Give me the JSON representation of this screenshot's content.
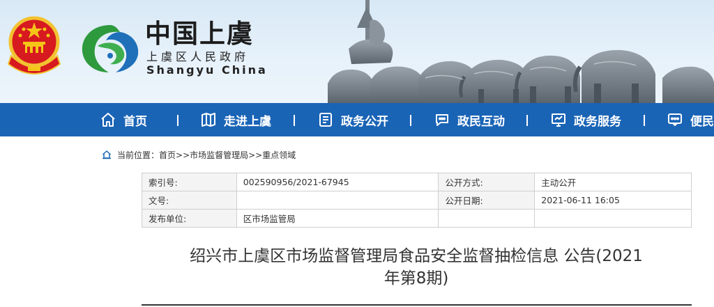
{
  "header": {
    "site_name": "中国上虞",
    "site_subtitle": "上虞区人民政府",
    "site_english": "Shangyu China"
  },
  "nav": {
    "items": [
      {
        "label": "首页",
        "icon": "home-icon"
      },
      {
        "label": "走进上虞",
        "icon": "map-icon"
      },
      {
        "label": "政务公开",
        "icon": "document-icon"
      },
      {
        "label": "政民互动",
        "icon": "chat-icon"
      },
      {
        "label": "政务服务",
        "icon": "monitor-icon"
      },
      {
        "label": "便民",
        "icon": "message-icon"
      }
    ]
  },
  "breadcrumb": {
    "prefix": "当前位置：",
    "path": "首页>>市场监督管理局>>重点领域"
  },
  "info": {
    "index_label": "索引号:",
    "index_value": "002590956/2021-67945",
    "publish_method_label": "公开方式:",
    "publish_method_value": "主动公开",
    "doc_no_label": "文号:",
    "doc_no_value": "",
    "publish_date_label": "公开日期:",
    "publish_date_value": "2021-06-11 16:05",
    "issuer_label": "发布单位:",
    "issuer_value": "区市场监管局"
  },
  "article": {
    "title_line1": "绍兴市上虞区市场监督管理局食品安全监督抽检信息 公告(2021",
    "title_line2": "年第8期)"
  },
  "colors": {
    "nav_bg": "#1a64b6",
    "header_bg": "#dcebf7",
    "logo_green": "#2e9a3e",
    "logo_blue": "#1f6fb9"
  }
}
